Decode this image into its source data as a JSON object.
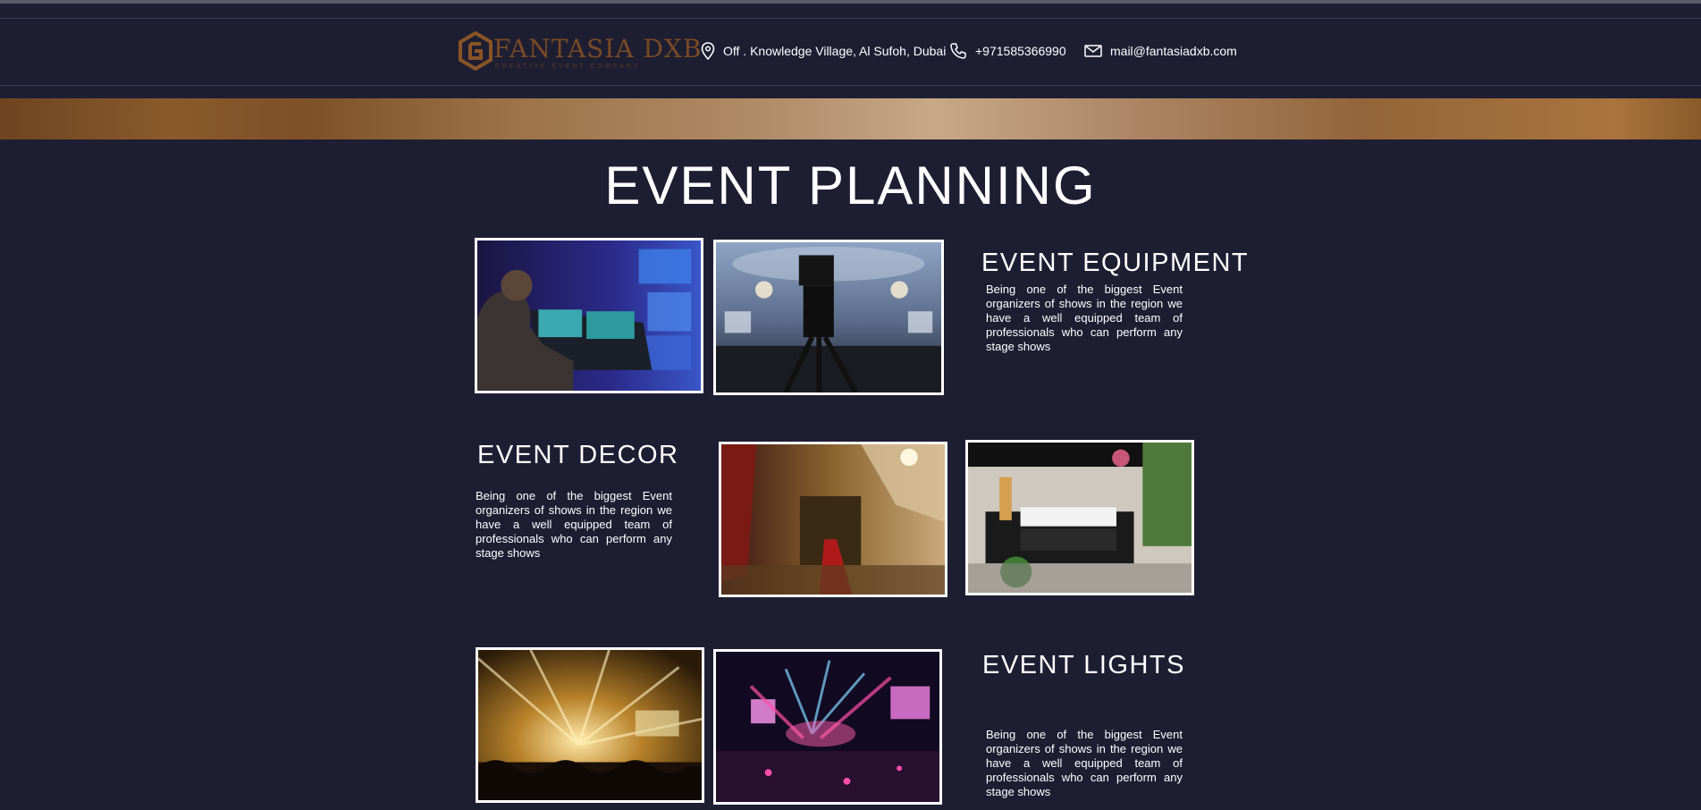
{
  "header": {
    "logo": {
      "name": "FANTASIA DXB",
      "tagline": "CREATIVE EVENT COMPANY",
      "icon": "hexagon-logo-icon"
    },
    "contacts": [
      {
        "icon": "location-pin-icon",
        "text": "Off . Knowledge Village, Al Sufoh, Dubai"
      },
      {
        "icon": "phone-icon",
        "text": "+971585366990"
      },
      {
        "icon": "mail-icon",
        "text": "mail@fantasiadxb.com"
      }
    ]
  },
  "colors": {
    "background": "#1e1e33",
    "gold": "#a9743e",
    "text": "#ffffff",
    "logo": "#7a4a24"
  },
  "page": {
    "title": "EVENT PLANNING"
  },
  "sections": [
    {
      "title": "EVENT EQUIPMENT",
      "text": "Being one of the biggest Event organizers of shows in the region we have a well equipped team of professionals who can perform any stage shows",
      "photos": [
        "lighting-console-photo",
        "camera-ballroom-photo"
      ]
    },
    {
      "title": "EVENT DECOR",
      "text": "Being one of the biggest Event organizers of shows in the region we have a well equipped team of professionals who can perform any stage shows",
      "photos": [
        "decor-hall-photo",
        "catering-display-photo"
      ]
    },
    {
      "title": "EVENT LIGHTS",
      "text": "Being one of the biggest Event organizers of shows in the region we have a well equipped team of professionals who can perform any stage shows",
      "photos": [
        "golden-lights-concert-photo",
        "pink-lights-concert-photo"
      ]
    }
  ]
}
